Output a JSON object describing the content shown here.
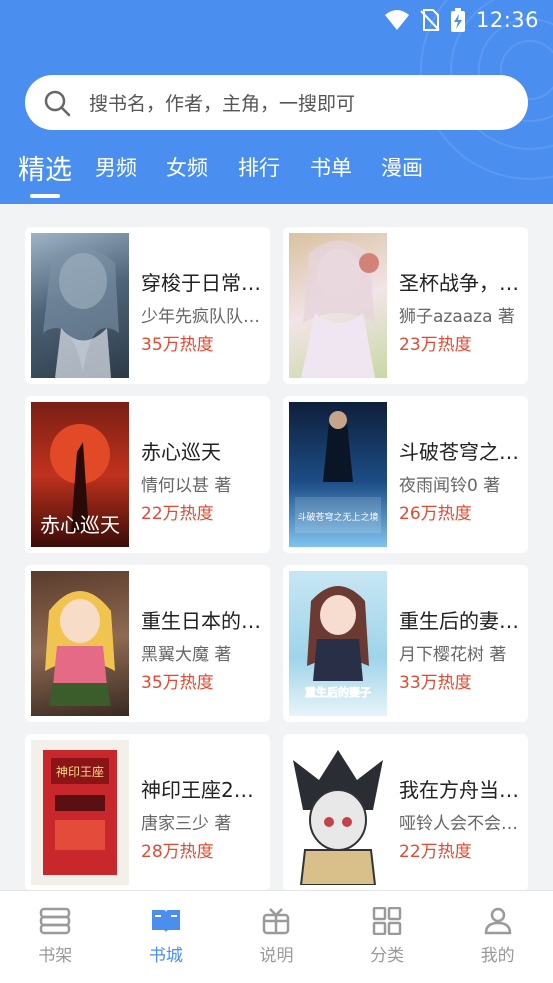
{
  "status_bar": {
    "time": "12:36"
  },
  "search": {
    "placeholder": "搜书名，作者，主角，一搜即可"
  },
  "tabs": [
    "精选",
    "男频",
    "女频",
    "排行",
    "书单",
    "漫画"
  ],
  "books": [
    {
      "title": "穿梭于日常…",
      "author": "少年先疯队队…",
      "heat": "35万热度"
    },
    {
      "title": "圣杯战争，…",
      "author": "狮子azaaza 著",
      "heat": "23万热度"
    },
    {
      "title": "赤心巡天",
      "author": "情何以甚 著",
      "heat": "22万热度",
      "cover_text": "赤心巡天"
    },
    {
      "title": "斗破苍穹之…",
      "author": "夜雨闻铃0 著",
      "heat": "26万热度",
      "cover_text": "斗破苍穹之无上之境"
    },
    {
      "title": "重生日本的…",
      "author": "黑翼大魔 著",
      "heat": "35万热度"
    },
    {
      "title": "重生后的妻…",
      "author": "月下樱花树 著",
      "heat": "33万热度",
      "cover_text": "重生后的妻子"
    },
    {
      "title": "神印王座2…",
      "author": "唐家三少 著",
      "heat": "28万热度",
      "cover_text": "神印王座"
    },
    {
      "title": "我在方舟当…",
      "author": "哑铃人会不会…",
      "heat": "22万热度"
    }
  ],
  "bottom_nav": [
    {
      "label": "书架",
      "icon": "bookshelf-icon"
    },
    {
      "label": "书城",
      "icon": "book-open-icon",
      "active": true
    },
    {
      "label": "说明",
      "icon": "gift-box-icon"
    },
    {
      "label": "分类",
      "icon": "grid-icon"
    },
    {
      "label": "我的",
      "icon": "person-icon"
    }
  ],
  "colors": {
    "primary": "#4a8ef0",
    "heat": "#e8472f"
  }
}
